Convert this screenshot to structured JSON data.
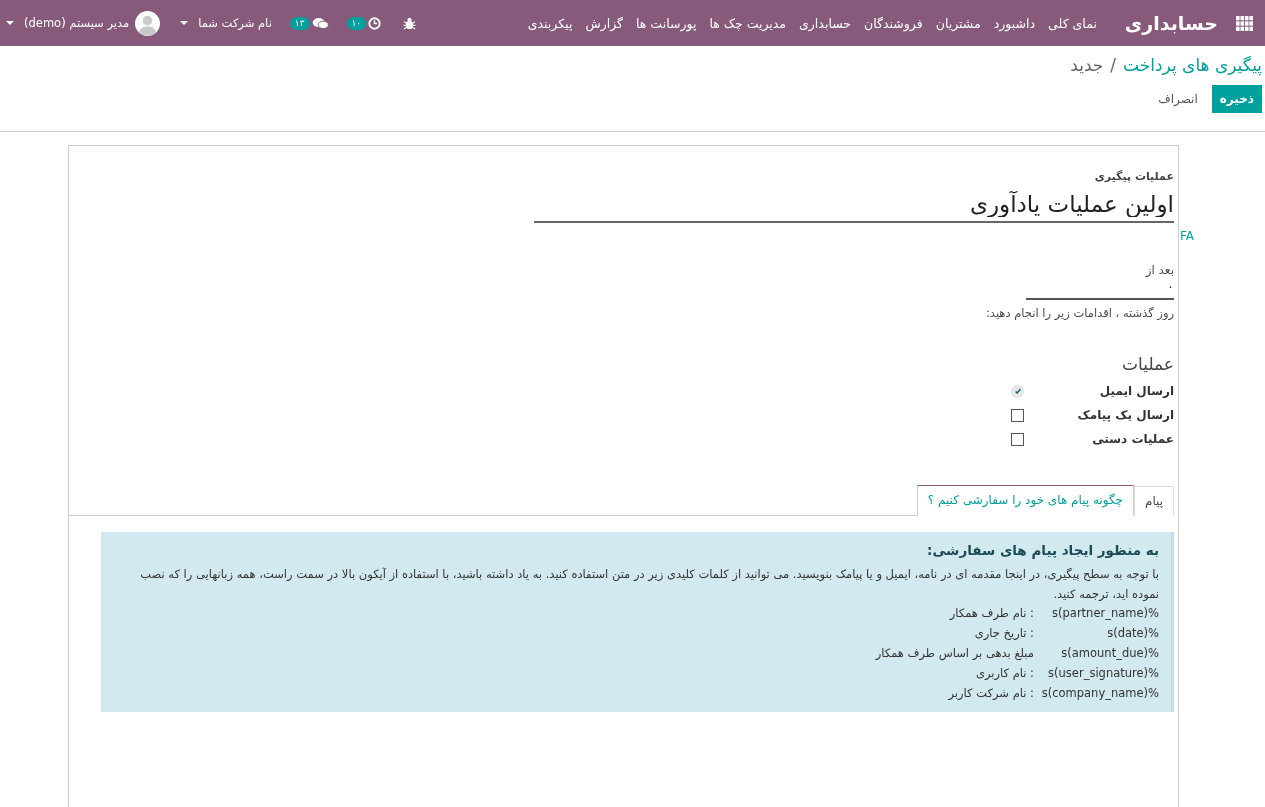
{
  "navbar": {
    "brand": "حسابداری",
    "menu": [
      {
        "label": "نمای کلی"
      },
      {
        "label": "داشبورد"
      },
      {
        "label": "مشتریان"
      },
      {
        "label": "فروشندگان"
      },
      {
        "label": "حسابداری"
      },
      {
        "label": "مدیریت چک ها"
      },
      {
        "label": "پورسانت ها"
      },
      {
        "label": "گزارش"
      },
      {
        "label": "پیکربندی"
      }
    ],
    "activities_badge": "۱۰",
    "messages_badge": "۱۳",
    "company": "نام شرکت شما",
    "user": "مدیر سیستم (demo)"
  },
  "breadcrumb": {
    "parent": "پیگیری های پرداخت",
    "separator": "/",
    "current": "جدید"
  },
  "buttons": {
    "save": "ذخیره",
    "discard": "انصراف"
  },
  "form": {
    "name_label": "عملیات پیگیری",
    "name_value": "اولین عملیات یادآوری",
    "lang_link": "FA",
    "delay_label": "بعد از",
    "delay_value": "۰",
    "delay_help": "روز گذشته ، اقدامات زیر را انجام دهید:",
    "actions_title": "عملیات",
    "actions": [
      {
        "label": "ارسال ایمیل",
        "checked": true,
        "disabled": true
      },
      {
        "label": "ارسال یک پیامک",
        "checked": false,
        "disabled": false
      },
      {
        "label": "عملیات دستی",
        "checked": false,
        "disabled": false
      }
    ]
  },
  "tabs": [
    {
      "label": "پیام",
      "selected": false
    },
    {
      "label": "چگونه پیام های خود را سفارشی کنیم ؟",
      "selected": true
    }
  ],
  "help": {
    "title": "به منظور ایجاد پیام های سفارشی:",
    "paragraph": "با توجه به سطح پیگیری، در اینجا مقدمه ای در نامه، ایمیل و یا پیامک بنویسید. می توانید از کلمات کلیدی زیر در متن استفاده کنید. به یاد داشته باشید، با استفاده از آیکون بالا در سمت راست، همه زبانهایی را که نصب نموده اید، ترجمه کنید.",
    "variables": [
      {
        "code": "%(partner_name)s",
        "description": ": نام طرف همکار"
      },
      {
        "code": "%(date)s",
        "description": ": تاریخ جاری"
      },
      {
        "code": "%(amount_due)s",
        "description": "مبلغ بدهی بر اساس طرف همکار"
      },
      {
        "code": "%(user_signature)s",
        "description": ": نام کاربری"
      },
      {
        "code": "%(company_name)s",
        "description": ": نام شرکت کاربر"
      }
    ]
  }
}
